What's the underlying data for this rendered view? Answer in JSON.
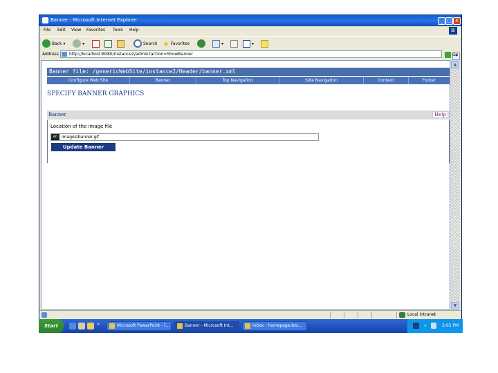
{
  "window": {
    "title": "Banner - Microsoft Internet Explorer",
    "controls": [
      "_",
      "□",
      "X"
    ]
  },
  "menu": [
    "File",
    "Edit",
    "View",
    "Favorites",
    "Tools",
    "Help"
  ],
  "toolbar": {
    "back": "Back",
    "search": "Search",
    "favorites": "Favorites"
  },
  "address": {
    "label": "Address",
    "url": "http://localhost:8080/instance2/admin?action=ShowBanner",
    "go": "Go"
  },
  "page": {
    "banner_file": "Banner file: /genericWebSite/instance2/Header/banner.xml",
    "nav": [
      "Configure Web Site",
      "Banner",
      "Top Navigation",
      "Side Navigation",
      "Content",
      "Footer"
    ],
    "title": "SPECIFY BANNER GRAPHICS",
    "section_label": "Banner",
    "help_label": "Help",
    "location_label": "Location of the image file",
    "path_prefix": "en",
    "path_value": "images/banner.gif",
    "update_button": "Update Banner"
  },
  "status": {
    "zone": "Local intranet"
  },
  "taskbar": {
    "start": "Start",
    "tasks": [
      "Microsoft PowerPoint - [...",
      "Banner - Microsoft Int...",
      "Inbox - homepage.bm..."
    ],
    "clock": "3:05 PM"
  }
}
